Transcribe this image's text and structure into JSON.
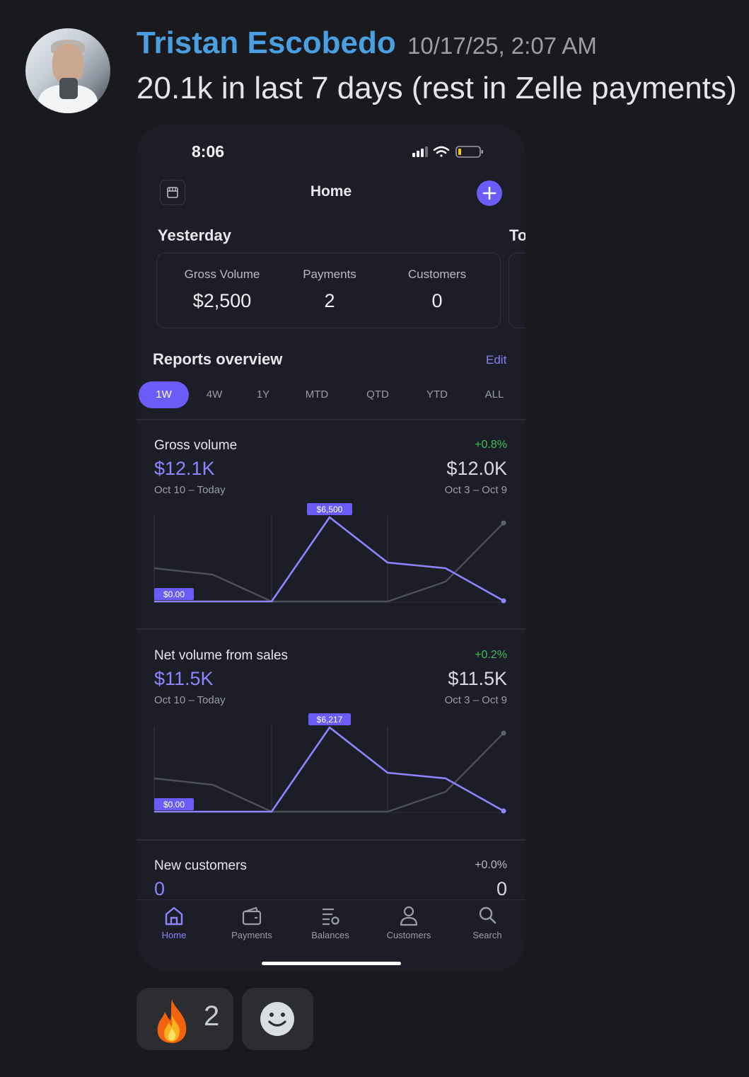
{
  "message": {
    "author": "Tristan Escobedo",
    "timestamp": "10/17/25, 2:07 AM",
    "text": "20.1k in last 7 days (rest in Zelle payments)"
  },
  "phone": {
    "status_time": "8:06",
    "header_title": "Home",
    "yesterday_label": "Yesterday",
    "today_label_partial": "To",
    "stats": [
      {
        "label": "Gross Volume",
        "value": "$2,500"
      },
      {
        "label": "Payments",
        "value": "2"
      },
      {
        "label": "Customers",
        "value": "0"
      }
    ],
    "reports_title": "Reports overview",
    "edit_label": "Edit",
    "periods": [
      "1W",
      "4W",
      "1Y",
      "MTD",
      "QTD",
      "YTD",
      "ALL"
    ],
    "active_period": "1W",
    "metrics": [
      {
        "title": "Gross volume",
        "change": "+0.8%",
        "value": "$12.1K",
        "prev_value": "$12.0K",
        "range": "Oct 10 – Today",
        "prev_range": "Oct 3 – Oct 9",
        "peak_label": "$6,500",
        "base_label": "$0.00"
      },
      {
        "title": "Net volume from sales",
        "change": "+0.2%",
        "value": "$11.5K",
        "prev_value": "$11.5K",
        "range": "Oct 10 – Today",
        "prev_range": "Oct 3 – Oct 9",
        "peak_label": "$6,217",
        "base_label": "$0.00"
      },
      {
        "title": "New customers",
        "change": "+0.0%",
        "value": "0",
        "prev_value": "0"
      }
    ],
    "tabs": [
      "Home",
      "Payments",
      "Balances",
      "Customers",
      "Search"
    ],
    "active_tab": "Home"
  },
  "reactions": [
    {
      "emoji": "fire",
      "count": "2"
    },
    {
      "emoji": "add-reaction"
    }
  ],
  "colors": {
    "accent": "#6b5cf7",
    "accent_text": "#8f84ff",
    "positive": "#3fbf5a",
    "author": "#4a9fe0"
  }
}
